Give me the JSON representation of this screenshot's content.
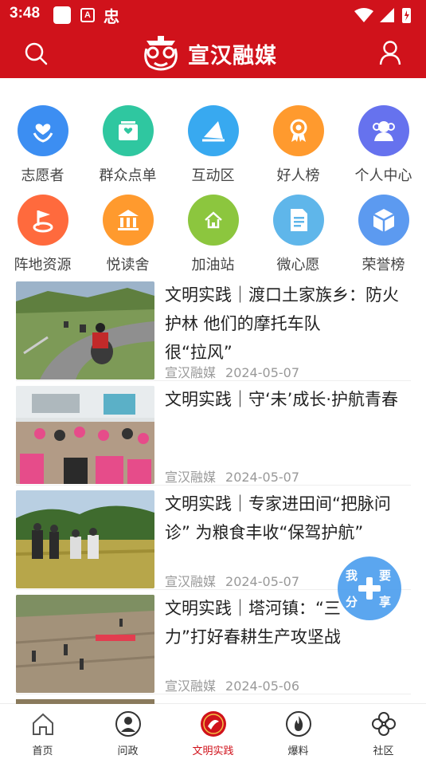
{
  "status_bar": {
    "time": "3:48",
    "indicator_a": "A",
    "indicator_char": "忠"
  },
  "header": {
    "brand_name": "宣汉融媒"
  },
  "colors": {
    "brand_red": "#d0121b",
    "fab_blue": "#4fa0ee"
  },
  "grid": [
    {
      "label": "志愿者",
      "icon": "volunteer-heart-icon",
      "color": "#3c8ef2"
    },
    {
      "label": "群众点单",
      "icon": "order-heart-icon",
      "color": "#2fc7a0"
    },
    {
      "label": "互动区",
      "icon": "paper-plane-icon",
      "color": "#38a9f0"
    },
    {
      "label": "好人榜",
      "icon": "medal-icon",
      "color": "#ff9a2e"
    },
    {
      "label": "个人中心",
      "icon": "users-icon",
      "color": "#6672ee"
    },
    {
      "label": "阵地资源",
      "icon": "flag-location-icon",
      "color": "#ff6a3d"
    },
    {
      "label": "悦读舍",
      "icon": "library-icon",
      "color": "#ff9a2e"
    },
    {
      "label": "加油站",
      "icon": "house-icon",
      "color": "#8cc63e"
    },
    {
      "label": "微心愿",
      "icon": "document-icon",
      "color": "#5fb6ea"
    },
    {
      "label": "荣誉榜",
      "icon": "cube-icon",
      "color": "#5c9af0"
    }
  ],
  "news": [
    {
      "title": "文明实践｜渡口土家族乡：防火护林 他们的摩托车队很“拉风”",
      "lines": [
        "文明实践｜渡口土家族乡：防火",
        "护林 他们的摩托车队",
        "很“拉风”"
      ],
      "source": "宣汉融媒",
      "date": "2024-05-07"
    },
    {
      "title": "文明实践｜守‘未’成长·护航青春",
      "lines": [
        "文明实践｜守‘未’成长·护航青春"
      ],
      "source": "宣汉融媒",
      "date": "2024-05-07"
    },
    {
      "title": "文明实践｜专家进田间“把脉问诊” 为粮食丰收“保驾护航”",
      "lines": [
        "文明实践｜专家进田间“把脉问",
        "诊” 为粮食丰收“保驾护航”"
      ],
      "source": "宣汉融媒",
      "date": "2024-05-07"
    },
    {
      "title": "文明实践｜塔河镇：“三",
      "lines": [
        "文明实践｜塔河镇：“三",
        "力”打好春耕生产攻坚战"
      ],
      "source": "宣汉融媒",
      "date": "2024-05-06"
    }
  ],
  "fab": {
    "c1": "我",
    "c2": "要",
    "c3": "分",
    "c4": "享"
  },
  "bottom_nav": [
    {
      "label": "首页",
      "icon": "home-icon",
      "active": false
    },
    {
      "label": "问政",
      "icon": "profile-circle-icon",
      "active": false
    },
    {
      "label": "文明实践",
      "icon": "civilization-emblem-icon",
      "active": true
    },
    {
      "label": "爆料",
      "icon": "flame-icon",
      "active": false
    },
    {
      "label": "社区",
      "icon": "clover-icon",
      "active": false
    }
  ]
}
